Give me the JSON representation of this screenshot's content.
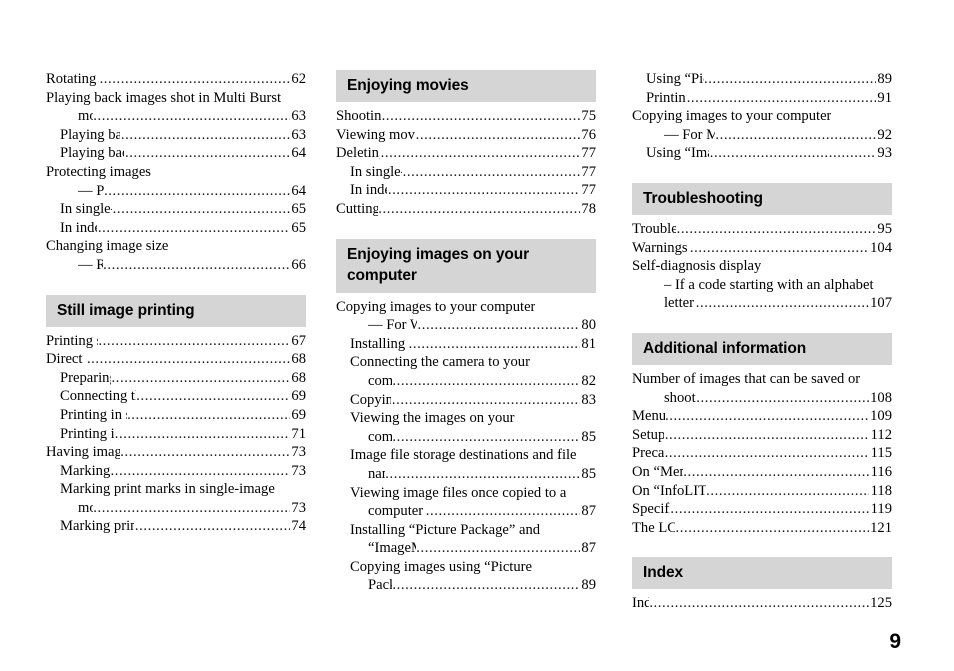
{
  "page_number": "9",
  "columns": [
    {
      "name": "column-left",
      "blocks": [
        {
          "type": "entries",
          "entries": [
            {
              "title": "Rotating still images",
              "page": "62",
              "indent": 0,
              "leader": true
            },
            {
              "title": "Playing back images shot in Multi Burst",
              "page": "",
              "indent": 0,
              "leader": false
            },
            {
              "title": "mode",
              "page": "63",
              "indent": 2,
              "leader": true
            },
            {
              "title": "Playing back continuously",
              "page": "63",
              "indent": 1,
              "leader": true
            },
            {
              "title": "Playing back frame by frame",
              "page": "64",
              "indent": 1,
              "leader": true
            },
            {
              "title": "Protecting images",
              "page": "",
              "indent": 0,
              "leader": false
            },
            {
              "title": "— Protect",
              "page": "64",
              "indent": 2,
              "leader": true
            },
            {
              "title": "In single-image mode",
              "page": "65",
              "indent": 1,
              "leader": true
            },
            {
              "title": "In index mode",
              "page": "65",
              "indent": 1,
              "leader": true
            },
            {
              "title": "Changing image size",
              "page": "",
              "indent": 0,
              "leader": false
            },
            {
              "title": "— Resize",
              "page": "66",
              "indent": 2,
              "leader": true
            }
          ]
        },
        {
          "type": "section",
          "gap": "large",
          "lines": [
            "Still image printing"
          ]
        },
        {
          "type": "entries",
          "entries": [
            {
              "title": "Printing still images",
              "page": "67",
              "indent": 0,
              "leader": true
            },
            {
              "title": "Direct printing",
              "page": "68",
              "indent": 0,
              "leader": true
            },
            {
              "title": "Preparing the camera",
              "page": "68",
              "indent": 1,
              "leader": true
            },
            {
              "title": "Connecting the camera to the printer",
              "page": "69",
              "indent": 1,
              "leader": true
            },
            {
              "title": "Printing in single-image mode",
              "page": "69",
              "indent": 1,
              "leader": true
            },
            {
              "title": "Printing in index mode",
              "page": "71",
              "indent": 1,
              "leader": true
            },
            {
              "title": "Having images printed at a shop",
              "page": "73",
              "indent": 0,
              "leader": true
            },
            {
              "title": "Marking print marks",
              "page": "73",
              "indent": 1,
              "leader": true
            },
            {
              "title": "Marking print marks in single-image",
              "page": "",
              "indent": 1,
              "leader": false
            },
            {
              "title": "mode",
              "page": "73",
              "indent": 2,
              "leader": true
            },
            {
              "title": "Marking print marks in index mode",
              "page": "74",
              "indent": 1,
              "leader": true
            }
          ]
        }
      ]
    },
    {
      "name": "column-middle",
      "blocks": [
        {
          "type": "section",
          "gap": "none",
          "lines": [
            "Enjoying movies"
          ]
        },
        {
          "type": "entries",
          "entries": [
            {
              "title": "Shooting movies",
              "page": "75",
              "indent": 0,
              "leader": true
            },
            {
              "title": "Viewing movies on the LCD screen",
              "page": "76",
              "indent": 0,
              "leader": true
            },
            {
              "title": "Deleting movies",
              "page": "77",
              "indent": 0,
              "leader": true
            },
            {
              "title": "In single-image mode",
              "page": "77",
              "indent": 1,
              "leader": true
            },
            {
              "title": "In index mode",
              "page": "77",
              "indent": 1,
              "leader": true
            },
            {
              "title": "Cutting movies",
              "page": "78",
              "indent": 0,
              "leader": true
            }
          ]
        },
        {
          "type": "section",
          "gap": "large",
          "lines": [
            "Enjoying images on your",
            "computer"
          ]
        },
        {
          "type": "entries",
          "entries": [
            {
              "title": "Copying images to your computer",
              "page": "",
              "indent": 0,
              "leader": false
            },
            {
              "title": "— For Windows users",
              "page": "80",
              "indent": 2,
              "leader": true
            },
            {
              "title": "Installing the USB driver",
              "page": "81",
              "indent": 1,
              "leader": true
            },
            {
              "title": "Connecting the camera to your",
              "page": "",
              "indent": 1,
              "leader": false
            },
            {
              "title": "computer",
              "page": "82",
              "indent": 2,
              "leader": true
            },
            {
              "title": "Copying images",
              "page": "83",
              "indent": 1,
              "leader": true
            },
            {
              "title": "Viewing the images on your",
              "page": "",
              "indent": 1,
              "leader": false
            },
            {
              "title": "computer",
              "page": "85",
              "indent": 2,
              "leader": true
            },
            {
              "title": "Image file storage destinations and file",
              "page": "",
              "indent": 1,
              "leader": false
            },
            {
              "title": "names",
              "page": "85",
              "indent": 2,
              "leader": true
            },
            {
              "title": "Viewing image files once copied to a",
              "page": "",
              "indent": 1,
              "leader": false
            },
            {
              "title": "computer with your camera",
              "page": "87",
              "indent": 2,
              "leader": true
            },
            {
              "title": "Installing “Picture Package” and",
              "page": "",
              "indent": 1,
              "leader": false
            },
            {
              "title": "“ImageMixer VCD2”",
              "page": "87",
              "indent": 2,
              "leader": true
            },
            {
              "title": "Copying images using “Picture",
              "page": "",
              "indent": 1,
              "leader": false
            },
            {
              "title": "Package”",
              "page": "89",
              "indent": 2,
              "leader": true
            }
          ]
        }
      ]
    },
    {
      "name": "column-right",
      "blocks": [
        {
          "type": "entries",
          "entries": [
            {
              "title": "Using “Picture Package”",
              "page": "89",
              "indent": 1,
              "leader": true
            },
            {
              "title": "Printing images",
              "page": "91",
              "indent": 1,
              "leader": true
            },
            {
              "title": "Copying images to your computer",
              "page": "",
              "indent": 0,
              "leader": false
            },
            {
              "title": "— For Macintosh users",
              "page": "92",
              "indent": 2,
              "leader": true
            },
            {
              "title": "Using “ImageMixer VCD2”",
              "page": "93",
              "indent": 1,
              "leader": true
            }
          ]
        },
        {
          "type": "section",
          "gap": "large",
          "lines": [
            "Troubleshooting"
          ]
        },
        {
          "type": "entries",
          "entries": [
            {
              "title": "Troubleshooting",
              "page": "95",
              "indent": 0,
              "leader": true
            },
            {
              "title": "Warnings and messages",
              "page": "104",
              "indent": 0,
              "leader": true
            },
            {
              "title": "Self-diagnosis display",
              "page": "",
              "indent": 0,
              "leader": false
            },
            {
              "title": "– If a code starting with an alphabet",
              "page": "",
              "indent": 2,
              "leader": false
            },
            {
              "title": "letter appears",
              "page": "107",
              "indent": 2,
              "leader": true
            }
          ]
        },
        {
          "type": "section",
          "gap": "large",
          "lines": [
            "Additional information"
          ]
        },
        {
          "type": "entries",
          "entries": [
            {
              "title": "Number of images that can be saved or",
              "page": "",
              "indent": 0,
              "leader": false
            },
            {
              "title": "shooting time",
              "page": "108",
              "indent": 2,
              "leader": true
            },
            {
              "title": "Menu items",
              "page": "109",
              "indent": 0,
              "leader": true
            },
            {
              "title": "Setup items",
              "page": "112",
              "indent": 0,
              "leader": true
            },
            {
              "title": "Precautions",
              "page": "115",
              "indent": 0,
              "leader": true
            },
            {
              "title": "On “Memory Stick”",
              "page": "116",
              "indent": 0,
              "leader": true
            },
            {
              "title": "On “InfoLITHIUM” battery pack",
              "page": "118",
              "indent": 0,
              "leader": true
            },
            {
              "title": "Specifications",
              "page": "119",
              "indent": 0,
              "leader": true
            },
            {
              "title": "The LCD screen",
              "page": "121",
              "indent": 0,
              "leader": true
            }
          ]
        },
        {
          "type": "section",
          "gap": "large",
          "lines": [
            "Index"
          ]
        },
        {
          "type": "entries",
          "entries": [
            {
              "title": "Index",
              "page": "125",
              "indent": 0,
              "leader": true
            }
          ]
        }
      ]
    }
  ]
}
